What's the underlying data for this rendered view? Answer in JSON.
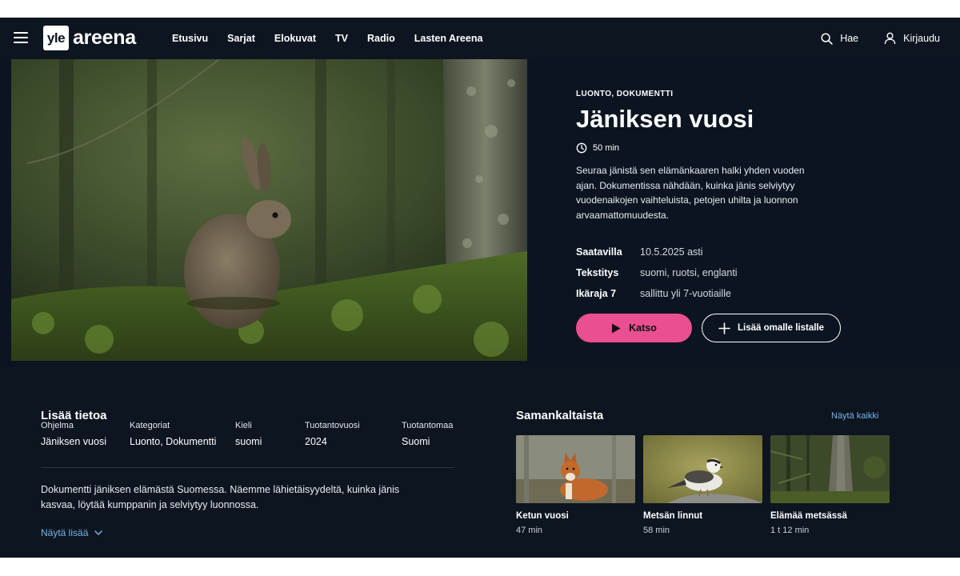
{
  "brand": {
    "box": "yle",
    "word": "areena"
  },
  "nav": {
    "links": [
      "Etusivu",
      "Sarjat",
      "Elokuvat",
      "TV",
      "Radio",
      "Lasten Areena"
    ],
    "search": "Hae",
    "login": "Kirjaudu"
  },
  "hero": {
    "genre": "LUONTO, DOKUMENTTI",
    "title": "Jäniksen vuosi",
    "duration": "50 min",
    "description": "Seuraa jänistä sen elämänkaaren halki yhden vuoden ajan. Dokumentissa nähdään, kuinka jänis selviytyy vuodenaikojen vaihteluista, petojen uhilta ja luonnon arvaamattomuudesta.",
    "meta": [
      {
        "label": "Saatavilla",
        "value": "10.5.2025 asti"
      },
      {
        "label": "Tekstitys",
        "value": "suomi, ruotsi, englanti"
      },
      {
        "label": "Ikäraja 7",
        "value": "sallittu yli 7-vuotiaille"
      }
    ],
    "watch_label": "Katso",
    "add_label": "Lisää omalle listalle"
  },
  "info": {
    "title": "Lisää tietoa",
    "fields": [
      {
        "label": "Ohjelma",
        "value": "Jäniksen vuosi"
      },
      {
        "label": "Kategoriat",
        "value": "Luonto, Dokumentti"
      },
      {
        "label": "Kieli",
        "value": "suomi"
      },
      {
        "label": "Tuotantovuosi",
        "value": "2024"
      },
      {
        "label": "Tuotantomaa",
        "value": "Suomi"
      }
    ],
    "about": "Dokumentti jäniksen elämästä Suomessa. Näemme lähietäisyydeltä, kuinka jänis kasvaa, löytää kumppanin ja selviytyy luonnossa.",
    "more": "Näytä lisää"
  },
  "similar": {
    "title": "Samankaltaista",
    "see_all": "Näytä kaikki",
    "items": [
      {
        "title": "Ketun vuosi",
        "duration": "47 min"
      },
      {
        "title": "Metsän linnut",
        "duration": "58 min"
      },
      {
        "title": "Elämää metsässä",
        "duration": "1 t 12 min"
      }
    ]
  },
  "colors": {
    "accent": "#ea4f91",
    "link": "#7ab6e6",
    "background": "#0a1420"
  }
}
